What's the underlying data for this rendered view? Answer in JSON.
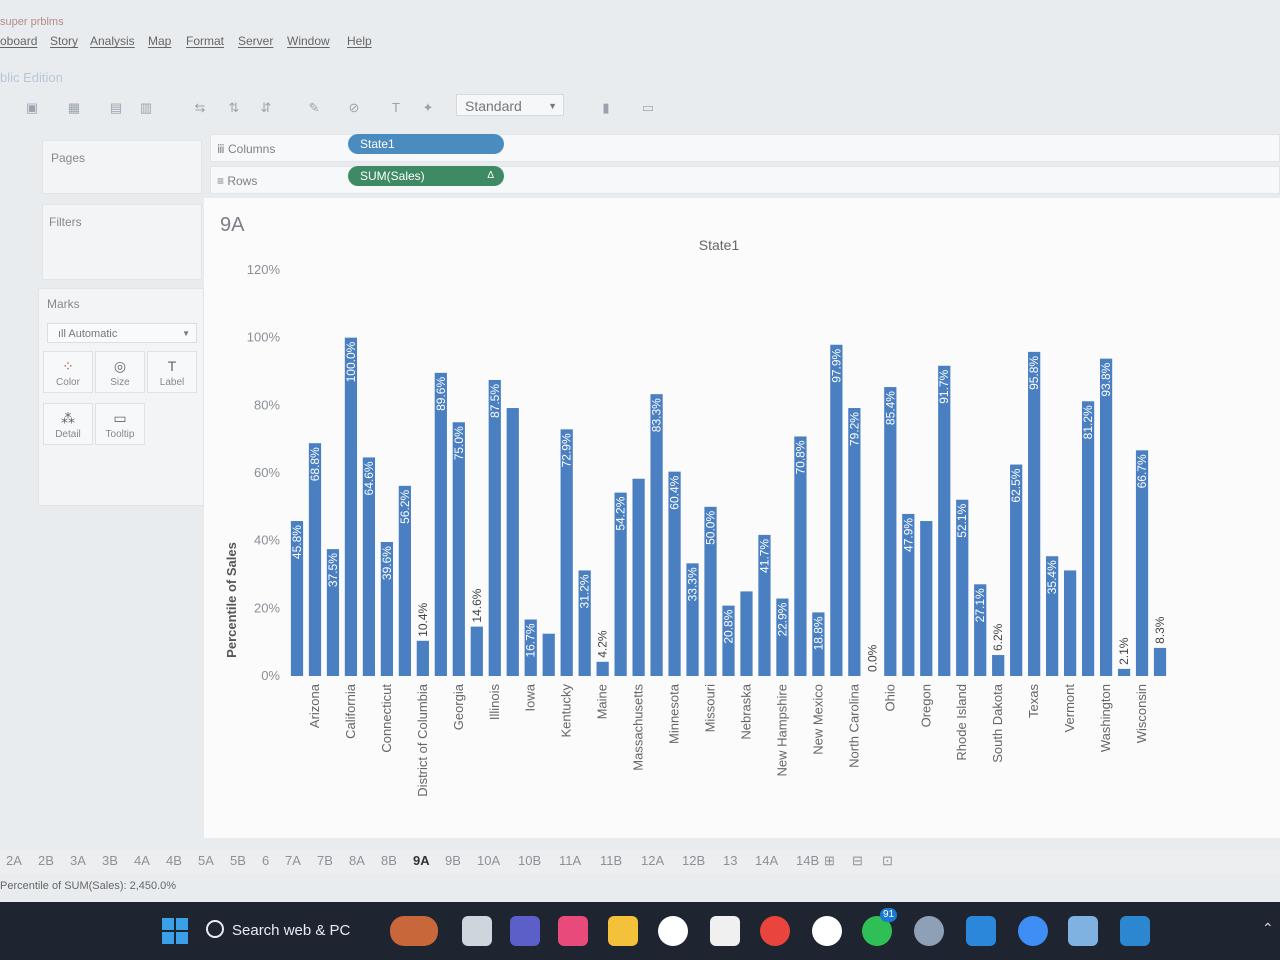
{
  "window": {
    "title": "super prblms",
    "edition": "blic Edition"
  },
  "menu": [
    "oboard",
    "Story",
    "Analysis",
    "Map",
    "Format",
    "Server",
    "Window",
    "Help"
  ],
  "toolbar": {
    "fit_select": "Standard"
  },
  "side": {
    "pages": "Pages",
    "filters": "Filters",
    "marks": "Marks",
    "mark_type": "Automatic",
    "mark_cards": [
      "Color",
      "Size",
      "Label",
      "Detail",
      "Tooltip"
    ]
  },
  "shelves": {
    "columns_label": "Columns",
    "rows_label": "Rows",
    "columns_pill": "State1",
    "rows_pill": "SUM(Sales)",
    "rows_pill_flag": "Δ"
  },
  "sheet": {
    "name": "9A"
  },
  "chart_data": {
    "type": "bar",
    "title": "State1",
    "ylabel": "Percentile of Sales",
    "xlabel": "",
    "ylim": [
      0,
      120
    ],
    "yticks": [
      "0%",
      "20%",
      "40%",
      "60%",
      "80%",
      "100%",
      "120%"
    ],
    "color": "#4a7fc1",
    "series": [
      {
        "category": "",
        "value": 45.8,
        "label": "45.8%"
      },
      {
        "category": "Arizona",
        "value": 68.8,
        "label": "68.8%"
      },
      {
        "category": "",
        "value": 37.5,
        "label": "37.5%"
      },
      {
        "category": "California",
        "value": 100.0,
        "label": "100.0%"
      },
      {
        "category": "",
        "value": 64.6,
        "label": "64.6%"
      },
      {
        "category": "Connecticut",
        "value": 39.6,
        "label": "39.6%"
      },
      {
        "category": "",
        "value": 56.2,
        "label": "56.2%"
      },
      {
        "category": "District of Columbia",
        "value": 10.4,
        "label": "10.4%"
      },
      {
        "category": "",
        "value": 89.6,
        "label": "89.6%"
      },
      {
        "category": "Georgia",
        "value": 75.0,
        "label": "75.0%"
      },
      {
        "category": "",
        "value": 14.6,
        "label": "14.6%"
      },
      {
        "category": "Illinois",
        "value": 87.5,
        "label": "87.5%"
      },
      {
        "category": "",
        "value": 79.2,
        "label": ""
      },
      {
        "category": "Iowa",
        "value": 16.7,
        "label": "16.7%"
      },
      {
        "category": "",
        "value": 12.5,
        "label": ""
      },
      {
        "category": "Kentucky",
        "value": 72.9,
        "label": "72.9%"
      },
      {
        "category": "",
        "value": 31.2,
        "label": "31.2%"
      },
      {
        "category": "Maine",
        "value": 4.2,
        "label": "4.2%"
      },
      {
        "category": "",
        "value": 54.2,
        "label": "54.2%"
      },
      {
        "category": "Massachusetts",
        "value": 58.3,
        "label": ""
      },
      {
        "category": "",
        "value": 83.3,
        "label": "83.3%"
      },
      {
        "category": "Minnesota",
        "value": 60.4,
        "label": "60.4%"
      },
      {
        "category": "",
        "value": 33.3,
        "label": "33.3%"
      },
      {
        "category": "Missouri",
        "value": 50.0,
        "label": "50.0%"
      },
      {
        "category": "",
        "value": 20.8,
        "label": "20.8%"
      },
      {
        "category": "Nebraska",
        "value": 25.0,
        "label": ""
      },
      {
        "category": "",
        "value": 41.7,
        "label": "41.7%"
      },
      {
        "category": "New Hampshire",
        "value": 22.9,
        "label": "22.9%"
      },
      {
        "category": "",
        "value": 70.8,
        "label": "70.8%"
      },
      {
        "category": "New Mexico",
        "value": 18.8,
        "label": "18.8%"
      },
      {
        "category": "",
        "value": 97.9,
        "label": "97.9%"
      },
      {
        "category": "North Carolina",
        "value": 79.2,
        "label": "79.2%"
      },
      {
        "category": "",
        "value": 0.0,
        "label": "0.0%"
      },
      {
        "category": "Ohio",
        "value": 85.4,
        "label": "85.4%"
      },
      {
        "category": "",
        "value": 47.9,
        "label": "47.9%"
      },
      {
        "category": "Oregon",
        "value": 45.8,
        "label": ""
      },
      {
        "category": "",
        "value": 91.7,
        "label": "91.7%"
      },
      {
        "category": "Rhode Island",
        "value": 52.1,
        "label": "52.1%"
      },
      {
        "category": "",
        "value": 27.1,
        "label": "27.1%"
      },
      {
        "category": "South Dakota",
        "value": 6.2,
        "label": "6.2%"
      },
      {
        "category": "",
        "value": 62.5,
        "label": "62.5%"
      },
      {
        "category": "Texas",
        "value": 95.8,
        "label": "95.8%"
      },
      {
        "category": "",
        "value": 35.4,
        "label": "35.4%"
      },
      {
        "category": "Vermont",
        "value": 31.2,
        "label": ""
      },
      {
        "category": "",
        "value": 81.2,
        "label": "81.2%"
      },
      {
        "category": "Washington",
        "value": 93.8,
        "label": "93.8%"
      },
      {
        "category": "",
        "value": 2.1,
        "label": "2.1%"
      },
      {
        "category": "Wisconsin",
        "value": 66.7,
        "label": "66.7%"
      },
      {
        "category": "",
        "value": 8.3,
        "label": "8.3%"
      }
    ]
  },
  "sheet_tabs": [
    "2A",
    "2B",
    "3A",
    "3B",
    "4A",
    "4B",
    "5A",
    "5B",
    "6",
    "7A",
    "7B",
    "8A",
    "8B",
    "9A",
    "9B",
    "10A",
    "10B",
    "11A",
    "11B",
    "12A",
    "12B",
    "13",
    "14A",
    "14B"
  ],
  "active_tab": "9A",
  "status": "Percentile of SUM(Sales): 2,450.0%",
  "taskbar": {
    "search": "Search web & PC",
    "whatsapp_badge": "91"
  }
}
